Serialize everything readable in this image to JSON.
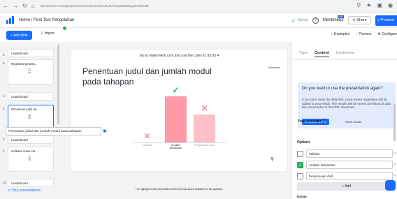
{
  "browser": {
    "nav_back": "←",
    "nav_forward": "→",
    "nav_reload": "↻",
    "nav_home": "⌂",
    "url": "mentimeter.com/app/presentation/al4z1cbcxfcybvs8ctq2th1kdcgsbnd8/edit",
    "ext_icons": [
      "⚲",
      "★",
      "▣",
      "◉"
    ]
  },
  "header": {
    "breadcrumb": "Home / Post Test Pengolahan",
    "saved": "Saved",
    "workspace": "Mentimeter",
    "pro_badge": "PRO",
    "share": "Share",
    "present": "Present",
    "help_icon": "?"
  },
  "toolbar": {
    "new_slide": "+ Add slide",
    "import": "Import",
    "examples": "Examples",
    "themes": "Themes",
    "configure": "Configure"
  },
  "slides": [
    {
      "num": "8",
      "title": "Leaderboard"
    },
    {
      "num": "9",
      "title": "Registrasi peserta..."
    },
    {
      "num": "1",
      "title": "Leaderboard"
    },
    {
      "num": "2",
      "title": "Penentuan judul da..."
    },
    {
      "num": "3",
      "title": "Leaderboard"
    },
    {
      "num": "4",
      "title": "Indikator untuk set..."
    },
    {
      "num": "10",
      "title": "Leaderboard"
    }
  ],
  "your_presentations": "Your presentations",
  "canvas": {
    "goto": "Go to www.menti.com and use the code 61 93 83 4",
    "question_title": "Penentuan judul dan jumlah modul pada tahapan",
    "logo_text": "Mentimeter",
    "footer": "The highlight of the presentation is the time and space available for this question."
  },
  "chart_data": {
    "type": "bar",
    "categories": [
      "Validasi",
      "Analisis kebutuhan",
      "Penyusunan draf"
    ],
    "values": [
      0,
      10,
      6
    ],
    "correct": [
      false,
      true,
      false
    ],
    "colors": [
      "#ff9aa9",
      "#ff9aa9",
      "#ffc0c8"
    ],
    "mark_correct_color": "#26b35a",
    "mark_wrong_color": "#ff8fa0"
  },
  "panel": {
    "tabs": [
      "Type",
      "Content",
      "Customize"
    ],
    "active_tab": "Content",
    "info_heading": "Do you want to use the presentation again?",
    "info_body": "If you don't reset the slide first, more recent responses will be added to your result. The results will be stored as historical data but not included in the PDF download.",
    "info_btn1": "Download results",
    "info_btn2": "Reset results",
    "your_question_label": "Your question",
    "your_question_value": "Penentuan judul dan jumlah modul pada tahapan",
    "options_label": "Options",
    "options": [
      {
        "text": "Validasi",
        "correct": false
      },
      {
        "text": "Analisis kebutuhan",
        "correct": true
      },
      {
        "text": "Penyusunan draf",
        "correct": false
      }
    ],
    "add_button": "+ Add",
    "next_section": "Extras"
  }
}
